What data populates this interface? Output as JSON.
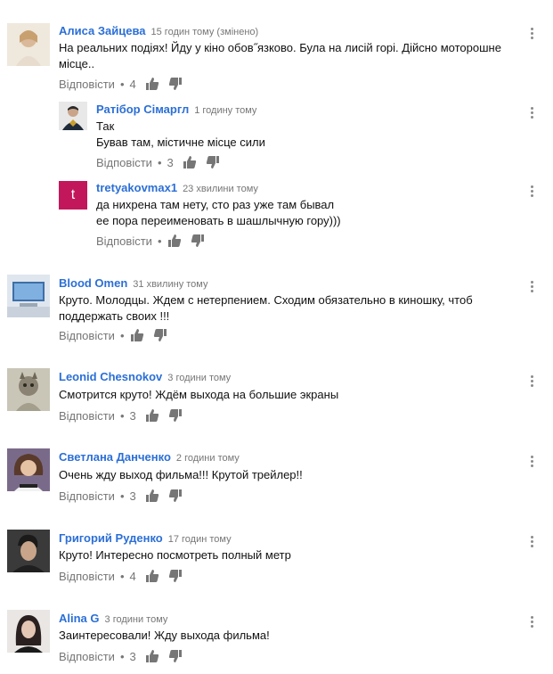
{
  "reply_label": "Відповісти",
  "separator": "•",
  "comments": [
    {
      "author": "Алиса Зайцева",
      "time": "15 годин тому (змінено)",
      "lines": [
        "На реальних подіях! Йду у кіно обов˝язково. Була на лисій горі. Дійсно моторошне",
        "місце.."
      ],
      "likes": "4",
      "avatar_color": "#d9c9b5"
    },
    {
      "author": "Ратібор Сімаргл",
      "time": "1 годину тому",
      "lines": [
        "Так",
        "Бував там, містичне місце сили"
      ],
      "likes": "3",
      "avatar_color": "#1e2b3a"
    },
    {
      "author": "tretyakovmax1",
      "time": "23 хвилини тому",
      "lines": [
        "да нихрена там нету, сто раз уже там бывал",
        "ее пора переименовать в шашлычную гору)))"
      ],
      "likes": "",
      "avatar_letter": "t",
      "avatar_color": "#c2185b"
    },
    {
      "author": "Blood Omen",
      "time": "31 хвилину тому",
      "lines": [
        "Круто. Молодцы. Ждем с нетерпением. Сходим обязательно в киношку, чтоб",
        "поддержать своих !!!"
      ],
      "likes": "",
      "avatar_color": "#8fa3b8"
    },
    {
      "author": "Leonid Chesnokov",
      "time": "3 години тому",
      "lines": [
        "Смотрится круто! Ждём выхода на большие экраны"
      ],
      "likes": "3",
      "avatar_color": "#9e9a8a"
    },
    {
      "author": "Светлана Данченко",
      "time": "2 години тому",
      "lines": [
        "Очень жду выход фильма!!! Крутой трейлер!!"
      ],
      "likes": "3",
      "avatar_color": "#6b4a3a"
    },
    {
      "author": "Григорий Руденко",
      "time": "17 годин тому",
      "lines": [
        "Круто! Интересно посмотреть полный метр"
      ],
      "likes": "4",
      "avatar_color": "#2f2f2f"
    },
    {
      "author": "Alina G",
      "time": "3 години тому",
      "lines": [
        "Заинтересовали! Жду выхода фильма!"
      ],
      "likes": "3",
      "avatar_color": "#3a3030"
    }
  ]
}
